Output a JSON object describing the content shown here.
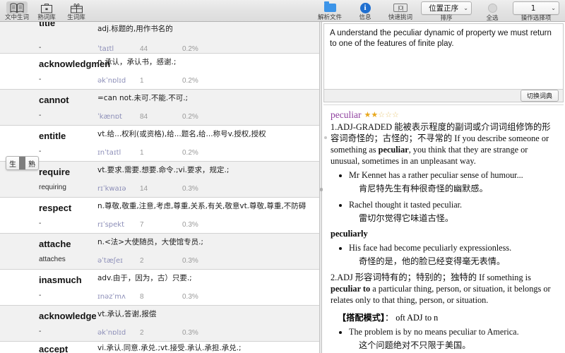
{
  "toolbar": {
    "left_items": [
      {
        "label": "文中生词",
        "icon": "open-book-icon",
        "selected": true
      },
      {
        "label": "熟词库",
        "icon": "briefcase-icon",
        "selected": false
      },
      {
        "label": "生词库",
        "icon": "gift-icon",
        "selected": false
      }
    ],
    "right_items": [
      {
        "label": "解析文件",
        "icon": "folder-icon"
      },
      {
        "label": "信息",
        "icon": "info-icon"
      },
      {
        "label": "快速挑词",
        "icon": "quick-pick-icon"
      }
    ],
    "sort": {
      "label": "排序",
      "value": "位置正序"
    },
    "select_all": {
      "label": "全选",
      "icon": "select-all-icon"
    },
    "action_select": {
      "label": "操作选择项",
      "value": "1"
    }
  },
  "toggle": {
    "raw": "生",
    "cooked": "熟"
  },
  "wordlist": {
    "columns": [
      "word",
      "form",
      "definition",
      "phonetic",
      "count",
      "percent"
    ],
    "rows": [
      {
        "word": "title",
        "form": "-",
        "definition": "adj.标题的,用作书名的",
        "phonetic": "ˈtaɪtl",
        "count": "44",
        "percent": "0.2%"
      },
      {
        "word": "acknowledgmen",
        "form": "-",
        "definition": "n.承认，承认书，感谢.;",
        "phonetic": "əkˈnɒlɪd",
        "count": "1",
        "percent": "0.2%"
      },
      {
        "word": "cannot",
        "form": "-",
        "definition": "=can not.未可.不能.不可.;",
        "phonetic": "ˈkænɒt",
        "count": "84",
        "percent": "0.2%"
      },
      {
        "word": "entitle",
        "form": "-",
        "definition": "vt.给...权利(或资格),给...题名,给...称号v.授权,授权",
        "phonetic": "ɪnˈtaɪtl",
        "count": "1",
        "percent": "0.2%"
      },
      {
        "word": "require",
        "form": "requiring",
        "definition": "vt.要求.需要.想要.命令.;vi.要求，规定.;",
        "phonetic": "rɪˈkwaɪə",
        "count": "14",
        "percent": "0.3%"
      },
      {
        "word": "respect",
        "form": "-",
        "definition": "n.尊敬,敬重,注意,考虑,尊重,关系,有关,敬意vt.尊敬,尊重,不防碍",
        "phonetic": "rɪˈspekt",
        "count": "7",
        "percent": "0.3%"
      },
      {
        "word": "attache",
        "form": "attaches",
        "definition": "n.<法>大使随员，大使馆专员.;",
        "phonetic": "əˈtæʃeɪ",
        "count": "2",
        "percent": "0.3%"
      },
      {
        "word": "inasmuch",
        "form": "-",
        "definition": "adv.由于，因为，古）只要.;",
        "phonetic": "ɪnəzˈmʌ",
        "count": "8",
        "percent": "0.3%"
      },
      {
        "word": "acknowledge",
        "form": "-",
        "definition": "vt.承认,答谢,报偿",
        "phonetic": "əkˈnɒlɪd",
        "count": "2",
        "percent": "0.3%"
      },
      {
        "word": "accept",
        "form": "-",
        "definition": "vi.承认.同意.承兑.;vt.接受.承认.承担.承兑.;",
        "phonetic": "",
        "count": "",
        "percent": ""
      }
    ]
  },
  "context": {
    "text": "A  understand the peculiar dynamic of property we must return to one of the features of finite play.",
    "switch_dict_label": "切换词典"
  },
  "dictionary": {
    "word": "peculiar",
    "stars_filled": 2,
    "stars_total": 5,
    "star_color": "#e8a81e",
    "word_color": "#8e3f9e",
    "senses": [
      {
        "number": "1.",
        "pos": "ADJ-GRADED",
        "text_before": "能被表示程度的副词或介词词组修饰的形容词奇怪的；古怪的；不寻常的 If you describe someone or something as ",
        "bold": "peculiar",
        "text_after": ", you think that they are strange or unusual, sometimes in an unpleasant way.",
        "examples": [
          {
            "en": "Mr Kennet has a rather peculiar sense of humour...",
            "cn": "肯尼特先生有种很奇怪的幽默感。"
          },
          {
            "en": "Rachel thought it tasted peculiar.",
            "cn": "雷切尔觉得它味道古怪。"
          }
        ],
        "subentry": "peculiarly",
        "sub_examples": [
          {
            "en": "His face had become peculiarly expressionless.",
            "cn": "奇怪的是，他的脸已经变得毫无表情。"
          }
        ]
      },
      {
        "number": "2.",
        "pos": "ADJ",
        "text_before": "形容词特有的；特别的；独特的 If something is ",
        "bold": "peculiar to",
        "text_after": " a particular thing, person, or situation, it belongs or relates only to that thing, person, or situation.",
        "pattern_label": "【搭配模式】",
        "pattern_value": "oft ADJ to n",
        "examples": [
          {
            "en": "The problem is by no means peculiar to America.",
            "cn": "这个问题绝对不只限于美国。"
          }
        ]
      }
    ]
  }
}
